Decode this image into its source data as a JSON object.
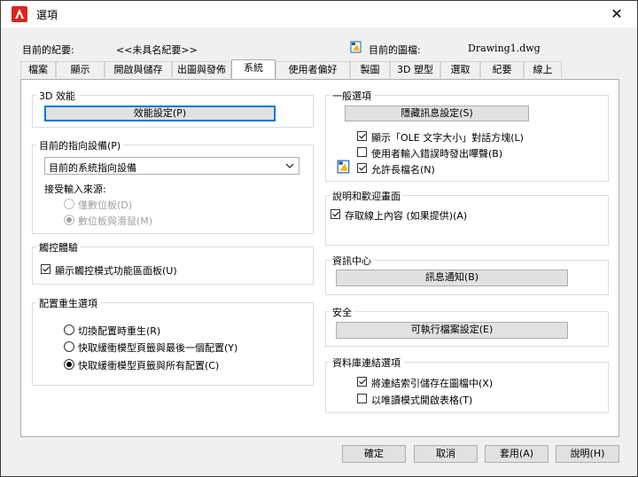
{
  "window": {
    "title": "選項",
    "close_glyph": "✕"
  },
  "profile": {
    "label": "目前的紀要:",
    "value": "<<未具名紀要>>"
  },
  "drawing": {
    "label": "目前的圖檔:",
    "value": "Drawing1.dwg"
  },
  "tabs": [
    "檔案",
    "顯示",
    "開啟與儲存",
    "出圖與發佈",
    "系統",
    "使用者偏好",
    "製圖",
    "3D 塑型",
    "選取",
    "紀要",
    "線上"
  ],
  "active_tab": "系統",
  "perf3d": {
    "title": "3D 效能",
    "button": "效能設定(P)"
  },
  "pointing": {
    "title": "目前的指向設備(P)",
    "selected": "目前的系統指向設備",
    "accept_label": "接受輸入來源:",
    "options": [
      {
        "label": "僅數位板(D)",
        "selected": false
      },
      {
        "label": "數位板與滑鼠(M)",
        "selected": true
      }
    ]
  },
  "touch": {
    "title": "觸控體驗",
    "checkbox": "顯示觸控模式功能區面板(U)",
    "checked": true
  },
  "regen": {
    "title": "配置重生選項",
    "options": [
      {
        "label": "切換配置時重生(R)",
        "selected": false
      },
      {
        "label": "快取緩衝模型頁籤與最後一個配置(Y)",
        "selected": false
      },
      {
        "label": "快取緩衝模型頁籤與所有配置(C)",
        "selected": true
      }
    ]
  },
  "general": {
    "title": "一般選項",
    "button": "隱藏訊息設定(S)",
    "checks": [
      {
        "label": "顯示「OLE 文字大小」對話方塊(L)",
        "checked": true
      },
      {
        "label": "使用者輸入錯誤時發出嗶聲(B)",
        "checked": false
      },
      {
        "label": "允許長檔名(N)",
        "checked": true
      }
    ]
  },
  "help": {
    "title": "說明和歡迎畫面",
    "checkbox": "存取線上內容 (如果提供)(A)",
    "checked": true
  },
  "infocenter": {
    "title": "資訊中心",
    "button": "訊息通知(B)"
  },
  "security": {
    "title": "安全",
    "button": "可執行檔案設定(E)"
  },
  "dblink": {
    "title": "資料庫連結選項",
    "checks": [
      {
        "label": "將連結索引儲存在圖檔中(X)",
        "checked": true
      },
      {
        "label": "以唯讀模式開啟表格(T)",
        "checked": false
      }
    ]
  },
  "buttons": {
    "ok": "確定",
    "cancel": "取消",
    "apply": "套用(A)",
    "help": "說明(H)"
  },
  "colors": {
    "accent": "#0078d7",
    "app_icon": "#d9261c"
  },
  "icons": {
    "app": "autocad-logo-icon",
    "drawing": "drawing-file-icon",
    "long_filename": "drawing-file-icon"
  }
}
